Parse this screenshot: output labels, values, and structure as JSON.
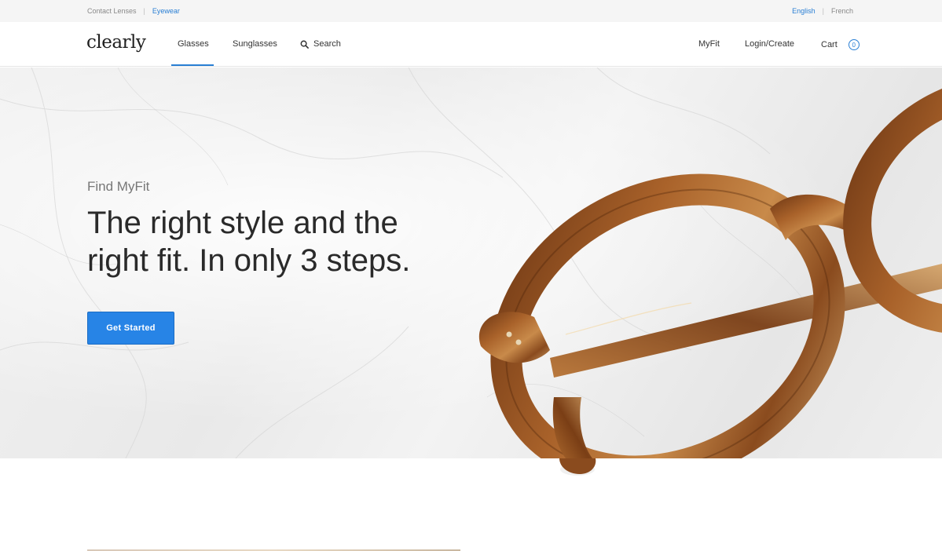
{
  "topbar": {
    "left_links": [
      {
        "label": "Contact Lenses",
        "active": false
      },
      {
        "label": "Eyewear",
        "active": true
      }
    ],
    "languages": [
      {
        "label": "English",
        "active": true
      },
      {
        "label": "French",
        "active": false
      }
    ],
    "separator": "|"
  },
  "nav": {
    "logo": "clearly",
    "glasses": "Glasses",
    "sunglasses": "Sunglasses",
    "search": "Search",
    "myfit": "MyFit",
    "login": "Login/Create",
    "cart": "Cart",
    "cart_count": "0",
    "active_tab": "Glasses"
  },
  "hero": {
    "eyebrow": "Find MyFit",
    "title": "The right style and the right fit. In only 3 steps.",
    "cta": "Get Started"
  },
  "colors": {
    "accent": "#2a7fd4",
    "button": "#2784e6",
    "frame_tortoise": "#8a4b1e"
  },
  "icons": {
    "search": "search-icon",
    "cart_badge": "cart-count-badge"
  }
}
